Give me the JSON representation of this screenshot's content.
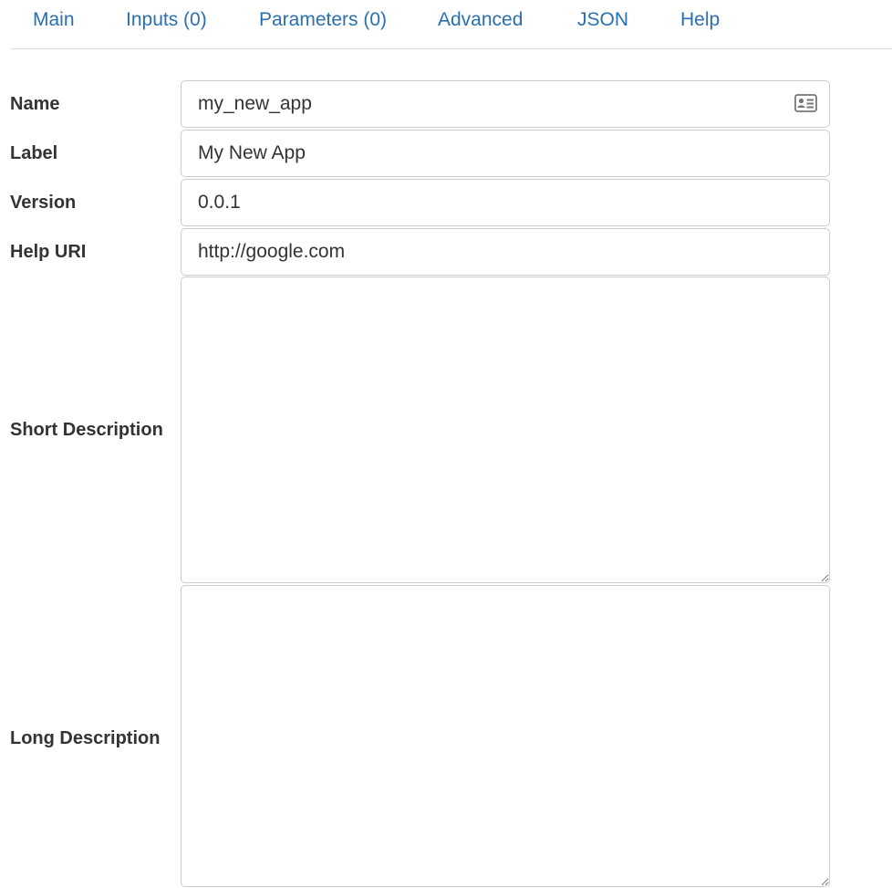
{
  "tabs": [
    {
      "label": "Main"
    },
    {
      "label": "Inputs (0)"
    },
    {
      "label": "Parameters (0)"
    },
    {
      "label": "Advanced"
    },
    {
      "label": "JSON"
    },
    {
      "label": "Help"
    }
  ],
  "form": {
    "name": {
      "label": "Name",
      "value": "my_new_app",
      "icon": "contact-card-icon"
    },
    "label": {
      "label": "Label",
      "value": "My New App"
    },
    "version": {
      "label": "Version",
      "value": "0.0.1"
    },
    "help_uri": {
      "label": "Help URI",
      "value": "http://google.com"
    },
    "short_description": {
      "label": "Short Description",
      "value": ""
    },
    "long_description": {
      "label": "Long Description",
      "value": ""
    }
  },
  "colors": {
    "link": "#2a6fb0",
    "border": "#cccccc",
    "text": "#333333"
  }
}
